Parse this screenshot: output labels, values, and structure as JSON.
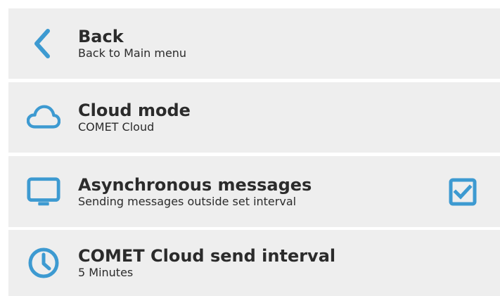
{
  "accent_color": "#3d9ad1",
  "items": [
    {
      "icon": "chevron-left-icon",
      "title": "Back",
      "subtitle": "Back to Main menu"
    },
    {
      "icon": "cloud-icon",
      "title": "Cloud mode",
      "subtitle": "COMET Cloud"
    },
    {
      "icon": "monitor-icon",
      "title": "Asynchronous messages",
      "subtitle": "Sending messages outside set interval",
      "checked": true
    },
    {
      "icon": "clock-icon",
      "title": "COMET Cloud send interval",
      "subtitle": "5 Minutes"
    }
  ]
}
